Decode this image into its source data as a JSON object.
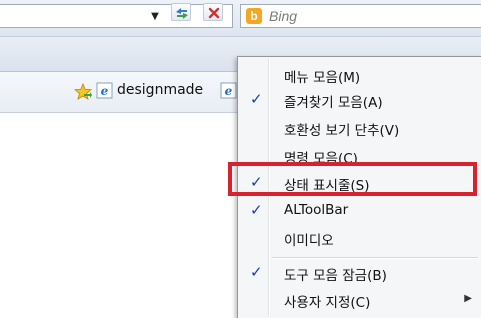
{
  "search": {
    "provider": "Bing",
    "logo_letter": "b",
    "logo_color": "#f5a623"
  },
  "toolbar": {
    "dropdown_icon": "dropdown-arrow-icon",
    "refresh_icon": "refresh-icon",
    "stop_icon": "stop-icon"
  },
  "favorites_bar": {
    "link_label": "designmade"
  },
  "context_menu": {
    "items": [
      {
        "label": "메뉴 모음(M)",
        "checked": false
      },
      {
        "label": "즐겨찾기 모음(A)",
        "checked": true
      },
      {
        "label": "호환성 보기 단추(V)",
        "checked": false
      },
      {
        "label": "명령 모음(C)",
        "checked": false
      },
      {
        "label": "상태 표시줄(S)",
        "checked": true
      },
      {
        "label": "ALToolBar",
        "checked": true
      },
      {
        "label": "이미디오",
        "checked": false
      },
      {
        "label": "도구 모음 잠금(B)",
        "checked": true
      },
      {
        "label": "사용자 지정(C)",
        "checked": false,
        "submenu": true
      }
    ],
    "check_mark": "✓",
    "submenu_arrow": "▶"
  },
  "colors": {
    "highlight_border": "#d7232f",
    "check_color": "#1a3fa8"
  }
}
